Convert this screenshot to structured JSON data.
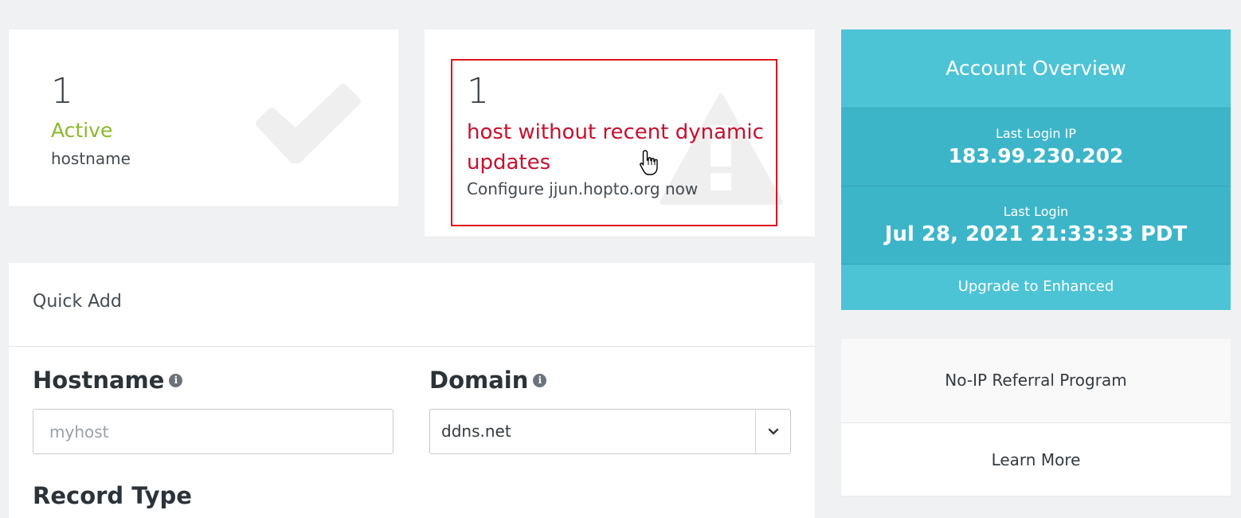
{
  "active_card": {
    "count": "1",
    "status": "Active",
    "sub": "hostname"
  },
  "warning_card": {
    "count": "1",
    "title": "host without recent dynamic updates",
    "sub": "Configure jjun.hopto.org now"
  },
  "overview": {
    "title": "Account Overview",
    "last_login_ip_label": "Last Login IP",
    "last_login_ip": "183.99.230.202",
    "last_login_label": "Last Login",
    "last_login": "Jul 28, 2021 21:33:33 PDT",
    "upgrade": "Upgrade to Enhanced"
  },
  "referral": {
    "title": "No-IP Referral Program",
    "learn_more": "Learn More"
  },
  "quick_add": {
    "title": "Quick Add",
    "hostname_label": "Hostname",
    "hostname_placeholder": "myhost",
    "domain_label": "Domain",
    "domain_value": "ddns.net",
    "record_type_label": "Record Type"
  },
  "colors": {
    "active_green": "#8ab92d",
    "warning_red": "#c8102e",
    "overview_teal": "#4dc3d6"
  }
}
